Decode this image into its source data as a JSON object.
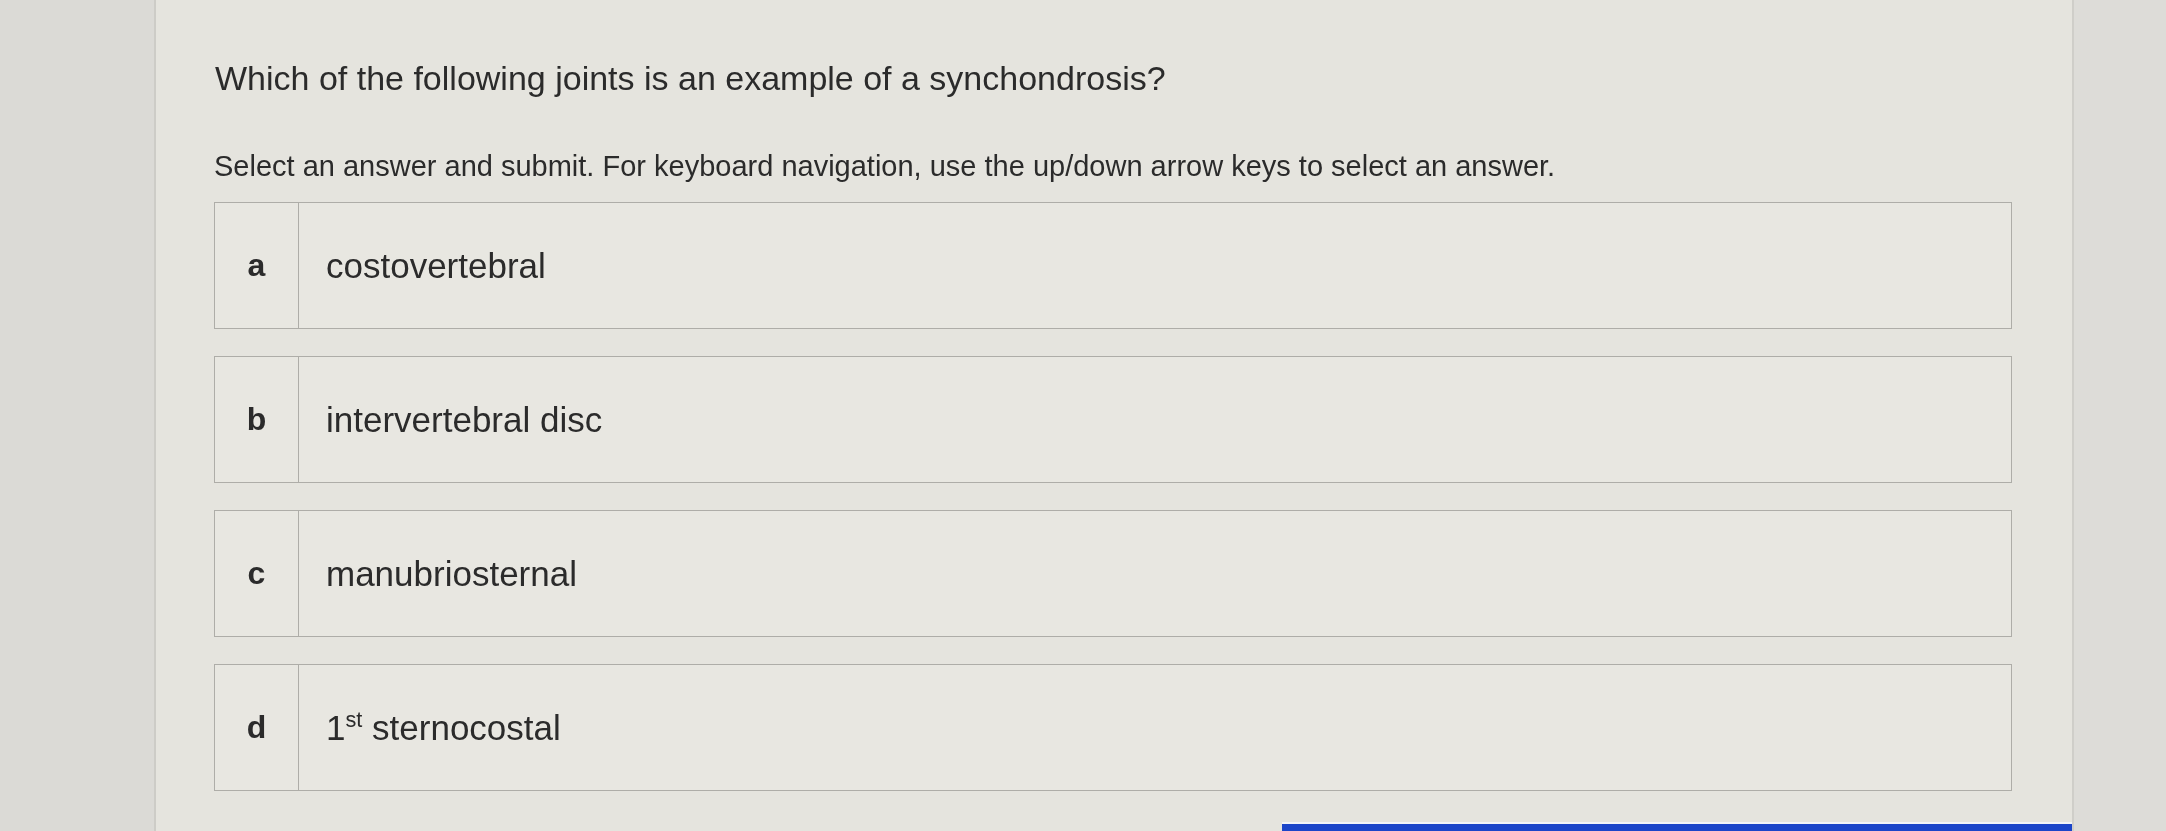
{
  "question": "Which of the following joints is an example of a synchondrosis?",
  "instructions": "Select an answer and submit. For keyboard navigation, use the up/down arrow keys to select an answer.",
  "options": [
    {
      "letter": "a",
      "text": "costovertebral",
      "selected": false
    },
    {
      "letter": "b",
      "text": "intervertebral disc",
      "selected": false
    },
    {
      "letter": "c",
      "text": "manubriosternal",
      "selected": false
    },
    {
      "letter": "d",
      "text": "1$^{st}$ sternocostal",
      "selected": false
    }
  ]
}
